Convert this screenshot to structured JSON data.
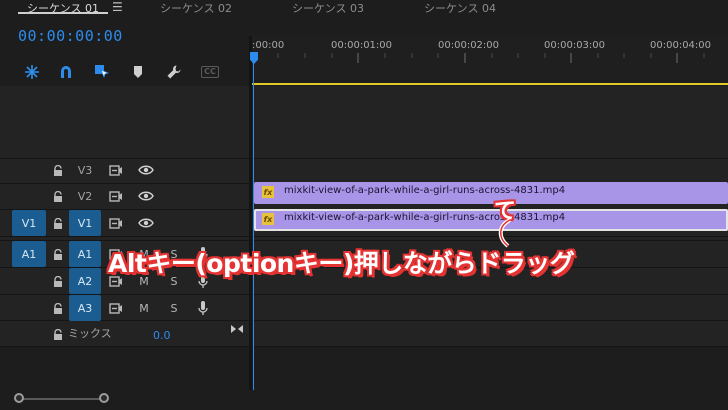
{
  "tabs": [
    {
      "label": "シーケンス 01",
      "active": true
    },
    {
      "label": "シーケンス 02",
      "active": false
    },
    {
      "label": "シーケンス 03",
      "active": false
    },
    {
      "label": "シーケンス 04",
      "active": false
    }
  ],
  "menu_icon": "☰",
  "timecode": "00:00:00:00",
  "toolbar_icons": [
    "snap-icon",
    "magnet-icon",
    "linked-selection-icon",
    "marker-icon",
    "wrench-icon",
    "captions-icon"
  ],
  "captions_label": "CC",
  "ruler_ticks": [
    ":00:00",
    "00:00:01:00",
    "00:00:02:00",
    "00:00:03:00",
    "00:00:04:00"
  ],
  "video_tracks": [
    {
      "source": "",
      "name": "V3"
    },
    {
      "source": "",
      "name": "V2"
    },
    {
      "source": "V1",
      "name": "V1"
    }
  ],
  "audio_tracks": [
    {
      "source": "A1",
      "name": "A1",
      "m": "M",
      "s": "S"
    },
    {
      "source": "",
      "name": "A2",
      "m": "M",
      "s": "S"
    },
    {
      "source": "",
      "name": "A3",
      "m": "M",
      "s": "S"
    }
  ],
  "mix": {
    "label": "ミックス",
    "value": "0.0"
  },
  "clips": [
    {
      "fx": "fx",
      "name": "mixkit-view-of-a-park-while-a-girl-runs-across-4831.mp4",
      "track": "V2",
      "selected": false
    },
    {
      "fx": "fx",
      "name": "mixkit-view-of-a-park-while-a-girl-runs-across-4831.mp4",
      "track": "V1",
      "selected": true
    }
  ],
  "annotation": {
    "main": "Altキー(optionキー)押しながらドラッグ",
    "small": "て"
  },
  "colors": {
    "accent": "#2d8ceb",
    "clip": "#a895e8",
    "work_area": "#e3c82a",
    "annotation_outline": "#e43332",
    "track_target": "#1c5d91"
  }
}
